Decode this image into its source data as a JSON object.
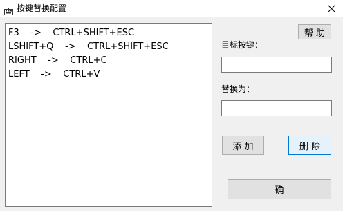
{
  "window": {
    "title": "按键替换配置"
  },
  "mappings": [
    "F3    ->    CTRL+SHIFT+ESC",
    "LSHIFT+Q    ->    CTRL+SHIFT+ESC",
    "RIGHT    ->    CTRL+C",
    "LEFT    ->    CTRL+V"
  ],
  "controls": {
    "help_label": "帮 助",
    "target_key_label": "目标按键：",
    "target_key_value": "",
    "replace_label": "替换为：",
    "replace_value": "",
    "add_label": "添 加",
    "delete_label": "删 除",
    "confirm_label": "确"
  },
  "icons": {
    "app": "keyboard-icon",
    "close": "close-icon"
  },
  "colors": {
    "focus_border": "#0078d7",
    "focus_bg": "#e5f1fb"
  }
}
